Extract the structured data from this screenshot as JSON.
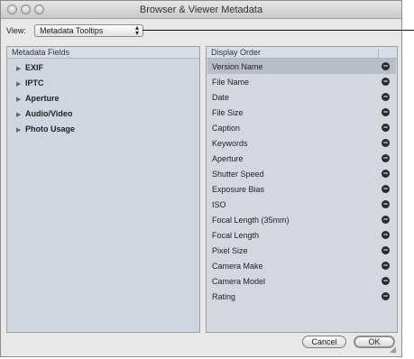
{
  "window": {
    "title": "Browser & Viewer Metadata"
  },
  "view": {
    "label": "View:",
    "selected": "Metadata Tooltips"
  },
  "metadata_fields": {
    "header": "Metadata Fields",
    "groups": [
      "EXIF",
      "IPTC",
      "Aperture",
      "Audio/Video",
      "Photo Usage"
    ]
  },
  "display_order": {
    "header": "Display Order",
    "items": [
      "Version Name",
      "File Name",
      "Date",
      "File Size",
      "Caption",
      "Keywords",
      "Aperture",
      "Shutter Speed",
      "Exposure Bias",
      "ISO",
      "Focal Length (35mm)",
      "Focal Length",
      "Pixel Size",
      "Camera Make",
      "Camera Model",
      "Rating"
    ],
    "selected_index": 0
  },
  "buttons": {
    "cancel": "Cancel",
    "ok": "OK"
  },
  "colors": {
    "pane_bg": "#cfd6e0",
    "selected_row": "#b8bec8"
  }
}
